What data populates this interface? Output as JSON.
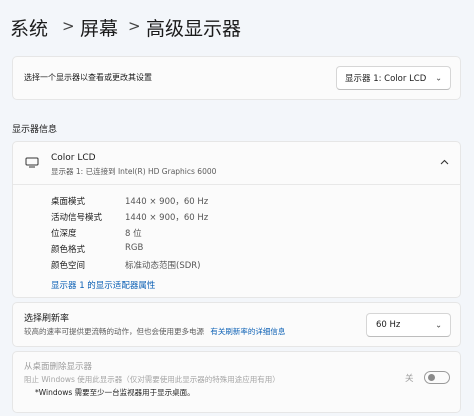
{
  "breadcrumb": {
    "items": [
      "系统",
      "屏幕",
      "高级显示器"
    ],
    "separator": ">"
  },
  "select_display": {
    "label": "选择一个显示器以查看或更改其设置",
    "value": "显示器 1: Color LCD"
  },
  "display_info": {
    "section_title": "显示器信息",
    "name": "Color LCD",
    "subtitle": "显示器 1: 已连接到 Intel(R) HD Graphics 6000",
    "rows": [
      {
        "key": "桌面模式",
        "value": "1440 × 900，60 Hz"
      },
      {
        "key": "活动信号模式",
        "value": "1440 × 900，60 Hz"
      },
      {
        "key": "位深度",
        "value": "8 位"
      },
      {
        "key": "颜色格式",
        "value": "RGB"
      },
      {
        "key": "颜色空间",
        "value": "标准动态范围(SDR)"
      }
    ],
    "adapter_link": "显示器 1 的显示适配器属性"
  },
  "refresh_rate": {
    "title": "选择刷新率",
    "description": "较高的速率可提供更流畅的动作，但也会使用更多电源",
    "link": "有关刷新率的详细信息",
    "value": "60 Hz"
  },
  "remove_display": {
    "title": "从桌面删除显示器",
    "description": "阻止 Windows 使用此显示器（仅对需要使用此显示器的特殊用途应用有用）",
    "toggle_label": "关",
    "toggle_on": false,
    "note": "*Windows 需要至少一台监视器用于显示桌面。"
  },
  "colors": {
    "accent": "#0a5fb4",
    "background": "#f3f6fa",
    "card": "#fbfbfb"
  }
}
